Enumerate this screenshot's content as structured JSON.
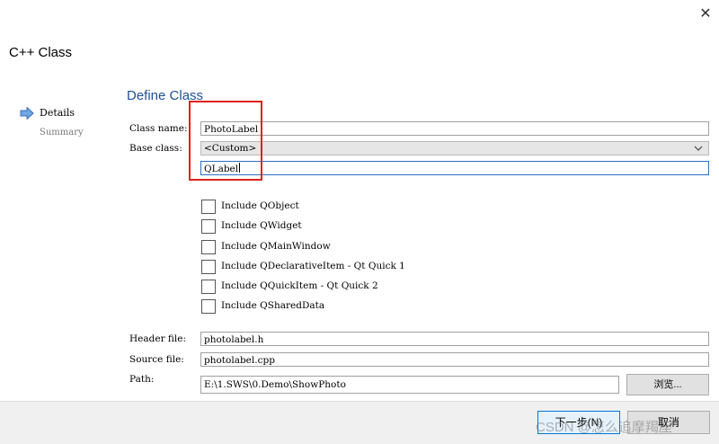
{
  "window": {
    "title": "C++ Class",
    "close_glyph": "✕"
  },
  "steps": [
    {
      "label": "Details",
      "current": true,
      "icon": "arrow-right-icon"
    },
    {
      "label": "Summary",
      "current": false
    }
  ],
  "section_title": "Define Class",
  "form": {
    "class_name_label": "Class name:",
    "class_name_value": "PhotoLabel",
    "base_class_label": "Base class:",
    "base_class_selected": "<Custom>",
    "custom_base_value": "QLabel",
    "header_file_label": "Header file:",
    "header_file_value": "photolabel.h",
    "source_file_label": "Source file:",
    "source_file_value": "photolabel.cpp",
    "path_label": "Path:",
    "path_value": "E:\\1.SWS\\0.Demo\\ShowPhoto",
    "browse_label": "浏览..."
  },
  "includes": [
    {
      "label": "Include QObject",
      "checked": false
    },
    {
      "label": "Include QWidget",
      "checked": false
    },
    {
      "label": "Include QMainWindow",
      "checked": false
    },
    {
      "label": "Include QDeclarativeItem - Qt Quick 1",
      "checked": false
    },
    {
      "label": "Include QQuickItem - Qt Quick 2",
      "checked": false
    },
    {
      "label": "Include QSharedData",
      "checked": false
    }
  ],
  "footer": {
    "next_label": "下一步(N)",
    "cancel_label": "取消",
    "watermark": "CSDN @怎么追摩羯座"
  },
  "colors": {
    "accent": "#1f4f99",
    "highlight_box": "#e02020",
    "focus_border": "#2b6fc2"
  }
}
